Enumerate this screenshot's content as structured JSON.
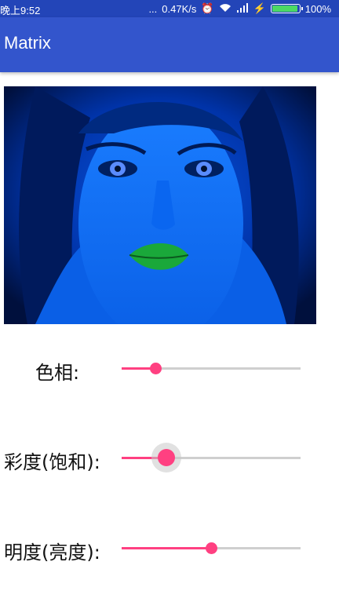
{
  "status_bar": {
    "time": "晚上9:52",
    "dots": "...",
    "speed": "0.47K/s",
    "battery": "100%"
  },
  "app_bar": {
    "title": "Matrix"
  },
  "adjustments": [
    {
      "label": "色相:",
      "value": 0.19
    },
    {
      "label": "彩度(饱和):",
      "value": 0.25,
      "pressed": true
    },
    {
      "label": "明度(亮度):",
      "value": 0.5
    }
  ],
  "colors": {
    "accent": "#ff4081",
    "primary": "#3355cc",
    "status_bar": "#2345b8"
  }
}
